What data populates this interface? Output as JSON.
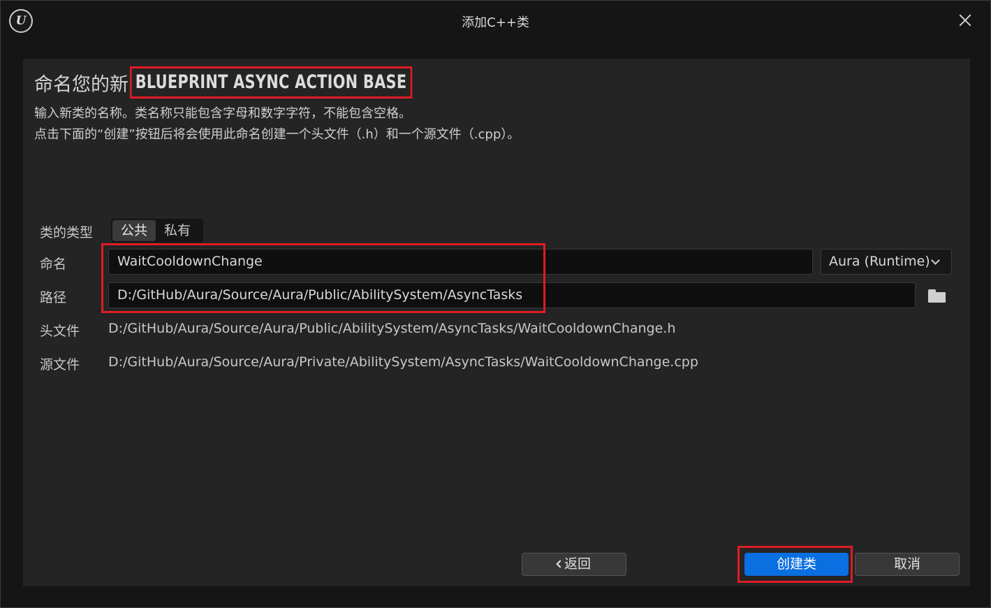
{
  "window": {
    "title": "添加C++类",
    "logo_icon": "unreal-engine-logo"
  },
  "heading": {
    "prefix": "命名您的新",
    "class_name": "BLUEPRINT ASYNC ACTION BASE",
    "description_line1": "输入新类的名称。类名称只能包含字母和数字字符，不能包含空格。",
    "description_line2": "点击下面的“创建”按钮后将会使用此命名创建一个头文件（.h）和一个源文件（.cpp）。"
  },
  "form": {
    "class_type_label": "类的类型",
    "class_type_options": [
      "公共",
      "私有"
    ],
    "class_type_selected": "公共",
    "name_label": "命名",
    "name_value": "WaitCooldownChange",
    "module_value": "Aura (Runtime)",
    "path_label": "路径",
    "path_value": "D:/GitHub/Aura/Source/Aura/Public/AbilitySystem/AsyncTasks",
    "header_label": "头文件",
    "header_value": "D:/GitHub/Aura/Source/Aura/Public/AbilitySystem/AsyncTasks/WaitCooldownChange.h",
    "source_label": "源文件",
    "source_value": "D:/GitHub/Aura/Source/Aura/Private/AbilitySystem/AsyncTasks/WaitCooldownChange.cpp"
  },
  "buttons": {
    "back_label": "返回",
    "create_label": "创建类",
    "cancel_label": "取消"
  },
  "colors": {
    "highlight": "#e01c24",
    "primary_button": "#0a6fe0"
  }
}
